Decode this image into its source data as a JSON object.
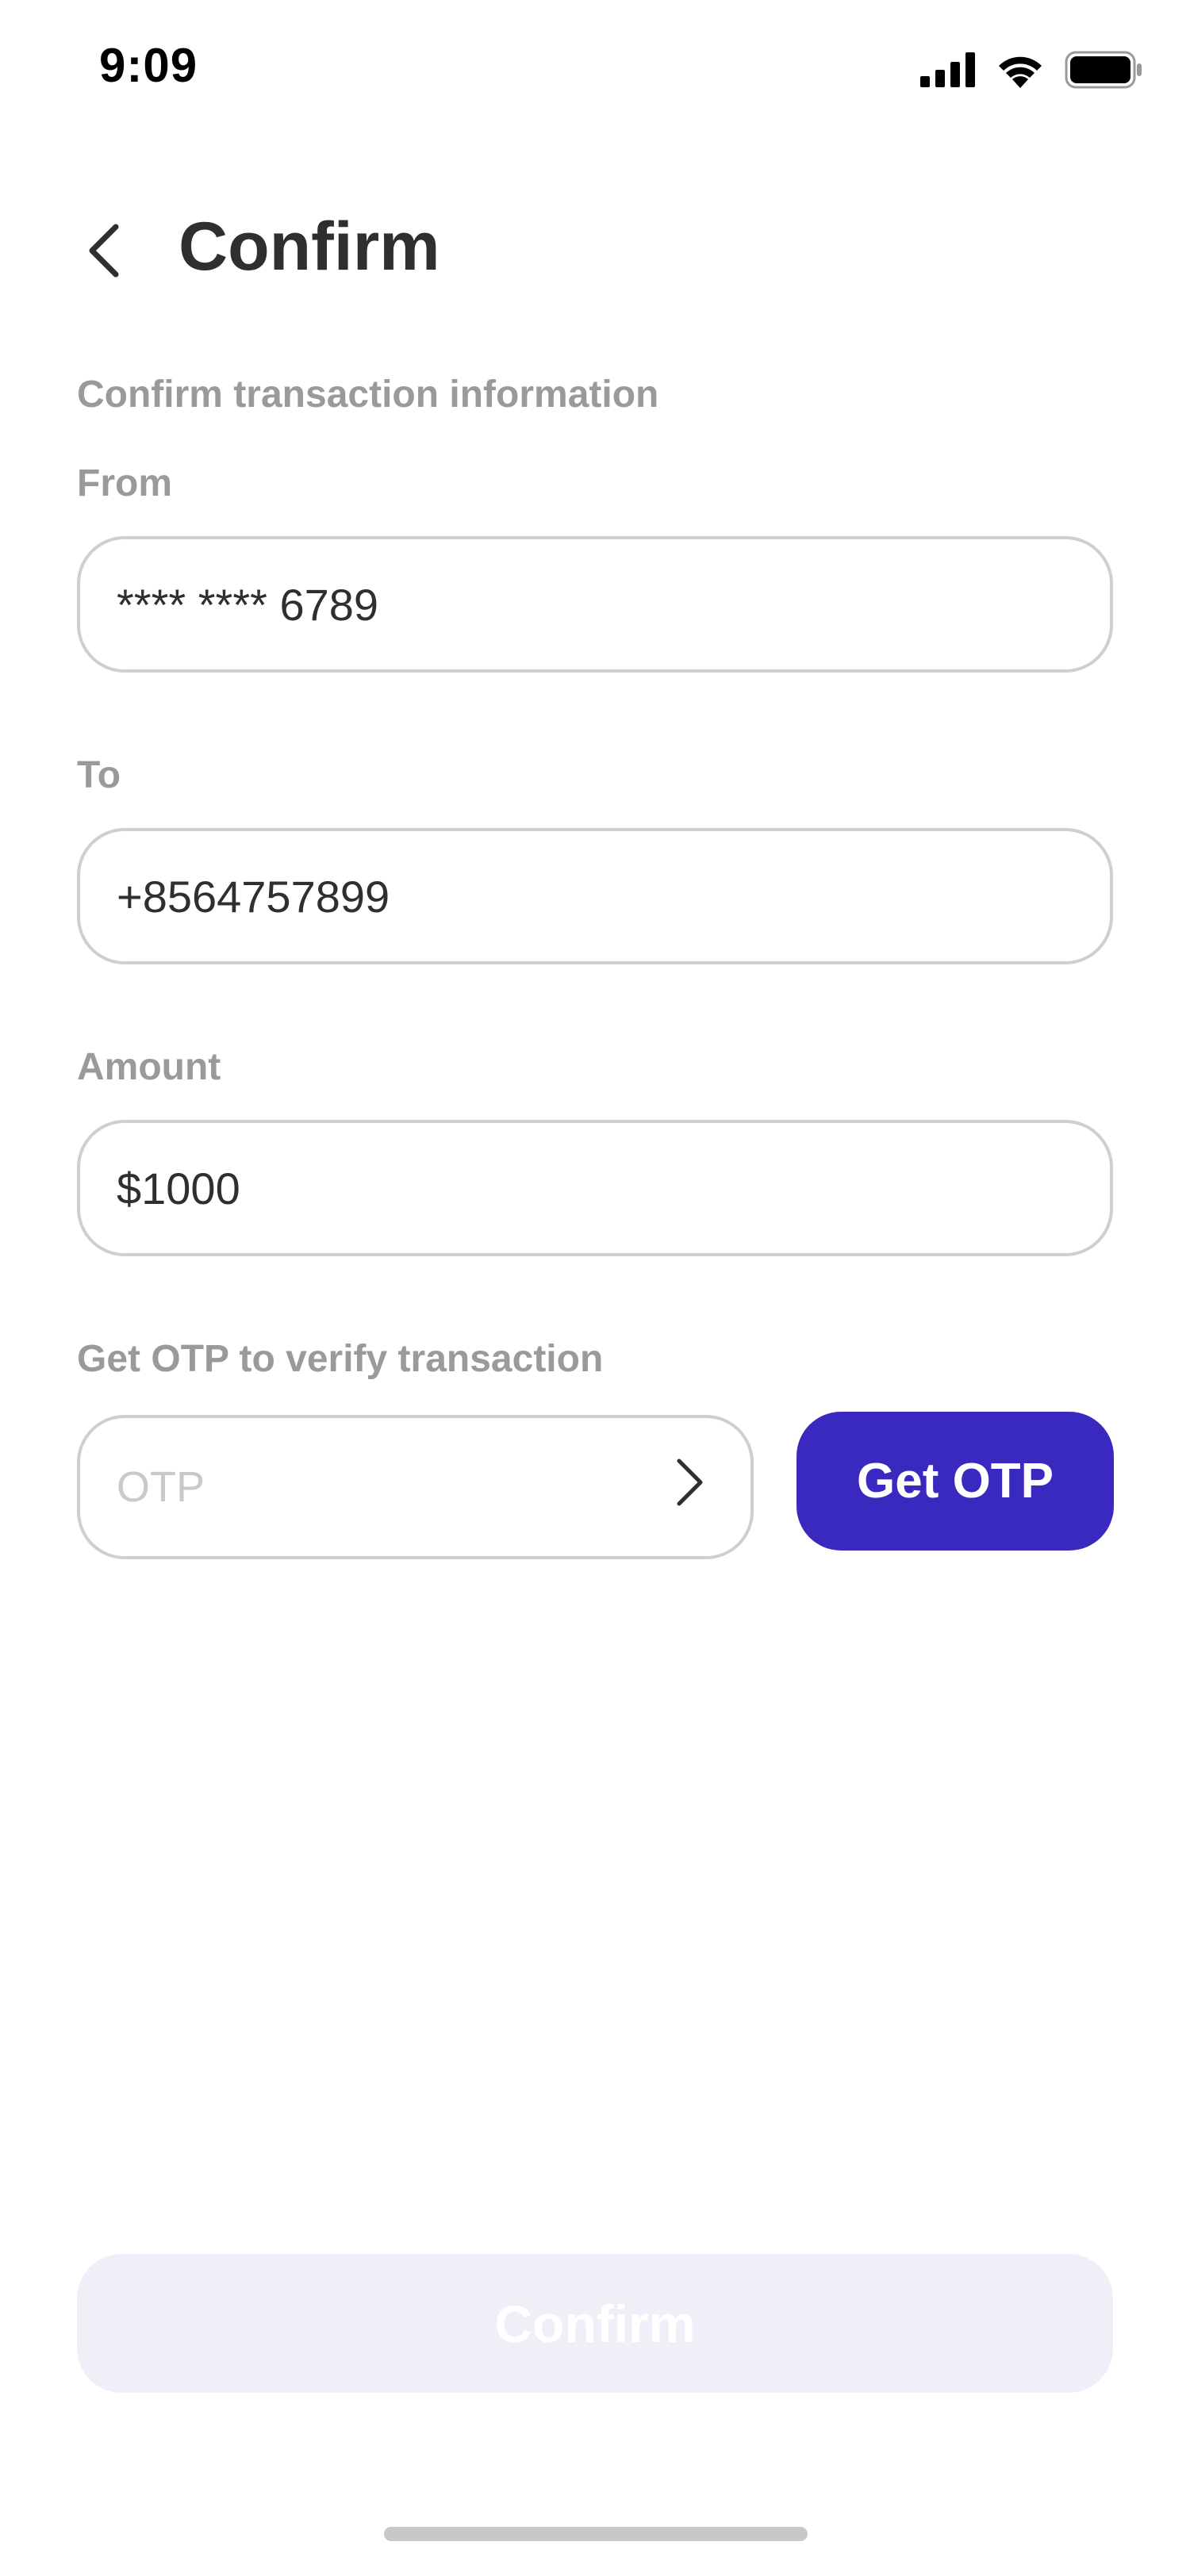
{
  "status_bar": {
    "time": "9:09",
    "icons": [
      "cellular-signal-icon",
      "wifi-icon",
      "battery-icon"
    ]
  },
  "header": {
    "back_icon": "chevron-left-icon",
    "title": "Confirm"
  },
  "form": {
    "section_heading": "Confirm transaction information",
    "from": {
      "label": "From",
      "value": "**** **** 6789"
    },
    "to": {
      "label": "To",
      "value": "+8564757899"
    },
    "amount": {
      "label": "Amount",
      "value": "$1000"
    },
    "otp": {
      "label": "Get OTP to verify transaction",
      "placeholder": "OTP",
      "value": "",
      "arrow_icon": "chevron-right-icon",
      "button_label": "Get OTP"
    }
  },
  "footer": {
    "confirm_label": "Confirm"
  },
  "colors": {
    "primary": "#3a29bf",
    "disabled_button": "#f0eff7",
    "label_text": "#9a9a9a",
    "body_text": "#2f2f2f",
    "border": "#cfcfcf"
  }
}
